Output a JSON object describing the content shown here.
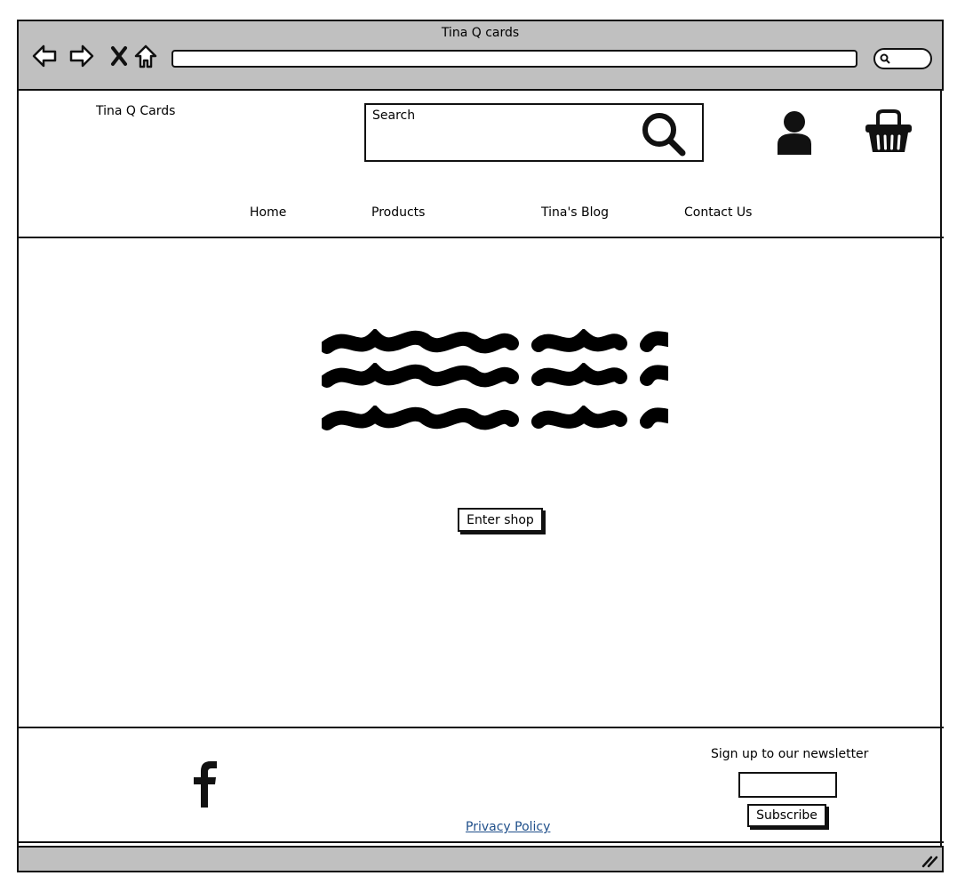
{
  "window": {
    "title": "Tina Q cards"
  },
  "header": {
    "brand": "Tina Q Cards",
    "search_placeholder": "Search",
    "icons": [
      "search-icon",
      "user-icon",
      "basket-icon"
    ]
  },
  "nav": {
    "home": "Home",
    "products": "Products",
    "blog": "Tina's Blog",
    "contact": "Contact Us"
  },
  "hero": {
    "button_label": "Enter shop"
  },
  "footer": {
    "social_icon": "facebook-icon",
    "privacy_label": "Privacy Policy",
    "newsletter_label": "Sign up to our newsletter",
    "subscribe_label": "Subscribe"
  },
  "colors": {
    "chrome": "#c0c0c0",
    "link": "#1f4f8a",
    "ink": "#111111"
  }
}
